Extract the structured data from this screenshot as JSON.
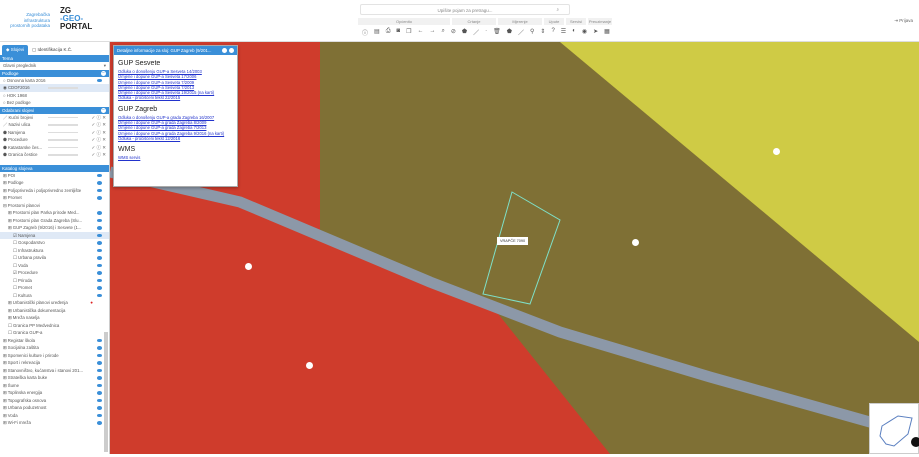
{
  "header": {
    "brand_lines": [
      "Zagrebačka",
      "infrastruktura",
      "prostornih podataka"
    ],
    "logo": [
      "ZG",
      "-GEO-",
      "PORTAL"
    ],
    "search_placeholder": "Upišite pojam za pretragu...",
    "groups": [
      "Općenito",
      "Crtanje",
      "Mjerenje",
      "Upute",
      "Servisi",
      "Preuzimanje"
    ],
    "login": "Prijava"
  },
  "sidebar": {
    "tabs": [
      "Slojevi",
      "Identifikacija K.Č."
    ],
    "tema_title": "Tema",
    "tema_value": "Glavni preglednik",
    "podloge_title": "Podloge",
    "podloge": [
      "Osnovna karta 2016",
      "CDOF2016",
      "HOK 1968",
      "Bez podloge"
    ],
    "odabrani_title": "Odabrani slojevi",
    "odabrani": [
      "Kućni brojevi",
      "Nazivi ulica",
      "Namjena",
      "Procedure",
      "Katastarske čes...",
      "Granica čestice"
    ],
    "katalog_title": "Katalog slojeva",
    "katalog": [
      "POI",
      "Podloge",
      "Poljoprivreda i poljoprivredno zemljište",
      "Promet",
      "Prostorni planovi",
      "Prostorni plan Parka prirode Med...",
      "Prostorni plan Grada Zagreba (Slu...",
      "GUP Zagreb (9/2016) i Sesvete (1...",
      "Namjena",
      "Gospodarstvo",
      "Infrastruktura",
      "Urbana pravila",
      "Voda",
      "Procedure",
      "Priroda",
      "Promet",
      "Kultura",
      "Urbanistički planovi uređenja",
      "Urbanistička dokumentacija",
      "Mreža naselja",
      "Granica PP Medvednica",
      "Granica GUP-a",
      "Registar škola",
      "Socijalna zaštita",
      "Spomenici kulture i prirode",
      "Sport i rekreacija",
      "Stanovništvo, kućanstva i stanovi 201...",
      "Strateška karta buke",
      "Šume",
      "Toplinska energija",
      "Topografska osnova",
      "Urbana poduzetnost",
      "Voda",
      "Wi-Fi mreža"
    ]
  },
  "popup": {
    "title": "Detaljne informacije za sloj: GUP Zagreb (9/201...",
    "sections": [
      {
        "heading": "GUP Sesvete",
        "links": [
          "Odluka o donošenju GUP-a Sesveta 14/2003",
          "Izmjene i dopune GUP-a Sesveta 17/2006",
          "Izmjene i dopune GUP-a Sesveta 7/2009",
          "Izmjene i dopune GUP-a Sesveta 7/2013",
          "Izmjene i dopune GUP-a Sesveta 19/2015 (na karti)",
          "Odluka - pročišćeni tekst 22/2015"
        ]
      },
      {
        "heading": "GUP Zagreb",
        "links": [
          "Odluka o donošenju GUP-a grada Zagreba 16/2007",
          "Izmjene i dopune GUP-a grada Zagreba 8/2009",
          "Izmjene i dopune GUP-a grada Zagreba 7/2013",
          "Izmjene i dopune GUP-a grada Zagreba 9/2016 (na karti)",
          "Odluka - pročišćeni tekst 12/2016"
        ]
      },
      {
        "heading": "WMS",
        "links": [
          "WMS servis"
        ]
      }
    ]
  },
  "map": {
    "parcel_label": "VRAPČE 7090",
    "colors": {
      "red": "#d9412f",
      "olive": "#8a7a3a",
      "yellow": "#d8d64a",
      "road": "#8c98a8",
      "accent": "#3a8fd8"
    }
  }
}
